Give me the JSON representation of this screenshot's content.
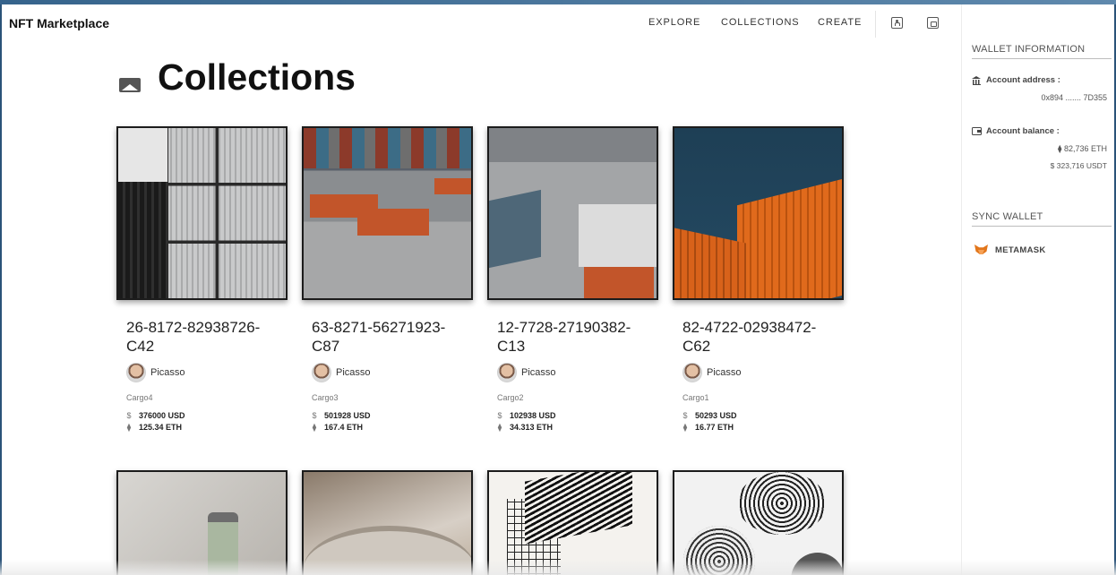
{
  "app": {
    "brand": "NFT Marketplace"
  },
  "nav": {
    "explore": "EXPLORE",
    "collections": "COLLECTIONS",
    "create": "CREATE"
  },
  "header_icons": [
    "account-box-icon",
    "wallet-icon"
  ],
  "page": {
    "title": "Collections",
    "title_icon": "collections-icon"
  },
  "sidebar": {
    "wallet_heading": "WALLET INFORMATION",
    "address_label": "Account address :",
    "address_value": "0x894 ....... 7D355",
    "balance_label": "Account balance :",
    "balance_eth": "82,736 ETH",
    "balance_usdt": "$ 323,716 USDT",
    "sync_heading": "SYNC WALLET",
    "metamask_label": "METAMASK"
  },
  "cards": [
    {
      "name": "26-8172-82938726-C42",
      "artist": "Picasso",
      "collection": "Cargo4",
      "usd": "376000 USD",
      "eth": "125.34 ETH"
    },
    {
      "name": "63-8271-56271923-C87",
      "artist": "Picasso",
      "collection": "Cargo3",
      "usd": "501928 USD",
      "eth": "167.4 ETH"
    },
    {
      "name": "12-7728-27190382-C13",
      "artist": "Picasso",
      "collection": "Cargo2",
      "usd": "102938 USD",
      "eth": "34.313 ETH"
    },
    {
      "name": "82-4722-02938472-C62",
      "artist": "Picasso",
      "collection": "Cargo1",
      "usd": "50293 USD",
      "eth": "16.77 ETH"
    }
  ],
  "symbols": {
    "usd": "$",
    "eth": "⧫"
  },
  "colors": {
    "background": "#2a5378",
    "text": "#222222",
    "accent": "#e2761b"
  }
}
